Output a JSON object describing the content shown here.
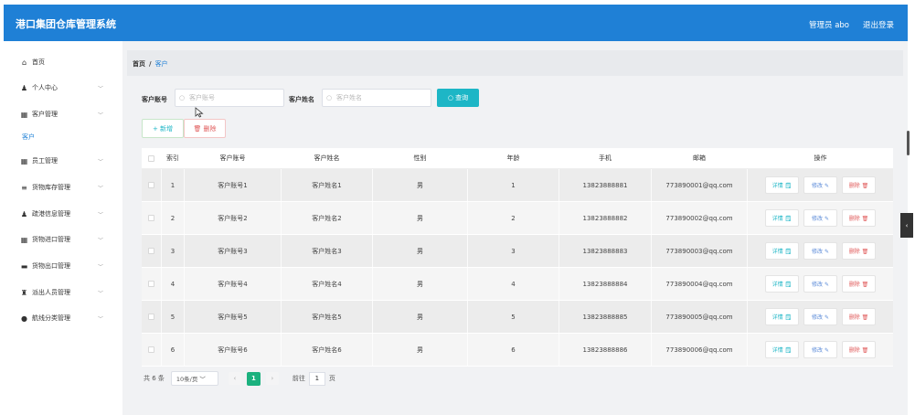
{
  "header": {
    "title": "港口集团仓库管理系统",
    "user": "管理员 abo",
    "logout": "退出登录"
  },
  "sidebar": {
    "items": [
      {
        "label": "首页",
        "icon": "home-icon",
        "glyph": "⌂",
        "chevron": ""
      },
      {
        "label": "个人中心",
        "icon": "user-icon",
        "glyph": "♟",
        "chevron": "﹀"
      },
      {
        "label": "客户管理",
        "icon": "grid-icon",
        "glyph": "▦",
        "chevron": "﹀"
      },
      {
        "label": "员工管理",
        "icon": "grid-icon",
        "glyph": "▦",
        "chevron": "﹀"
      },
      {
        "label": "货物库存管理",
        "icon": "list-icon",
        "glyph": "≡",
        "chevron": "﹀"
      },
      {
        "label": "疏港信息管理",
        "icon": "user-icon",
        "glyph": "♟",
        "chevron": "﹀"
      },
      {
        "label": "货物进口管理",
        "icon": "grid-icon",
        "glyph": "▦",
        "chevron": "﹀"
      },
      {
        "label": "货物出口管理",
        "icon": "ship-icon",
        "glyph": "▬",
        "chevron": "﹀"
      },
      {
        "label": "派出人员管理",
        "icon": "person-icon",
        "glyph": "♜",
        "chevron": "﹀"
      },
      {
        "label": "航线分类管理",
        "icon": "pin-icon",
        "glyph": "●",
        "chevron": "﹀"
      }
    ],
    "submenu_label": "客户"
  },
  "breadcrumb": {
    "home": "首页",
    "sep": "/",
    "current": "客户"
  },
  "filters": {
    "account_label": "客户账号",
    "account_placeholder": "客户账号",
    "name_label": "客户姓名",
    "name_placeholder": "客户姓名",
    "search_glyph": "○",
    "query_button": "○ 查询"
  },
  "actions": {
    "add": "+ 新增",
    "delete": "🗑 删除"
  },
  "table": {
    "headers": [
      "",
      "索引",
      "客户账号",
      "客户姓名",
      "性别",
      "年龄",
      "手机",
      "邮箱",
      "操作"
    ],
    "rows": [
      {
        "idx": "1",
        "account": "客户账号1",
        "name": "客户姓名1",
        "gender": "男",
        "age": "1",
        "phone": "13823888881",
        "email": "773890001@qq.com"
      },
      {
        "idx": "2",
        "account": "客户账号2",
        "name": "客户姓名2",
        "gender": "男",
        "age": "2",
        "phone": "13823888882",
        "email": "773890002@qq.com"
      },
      {
        "idx": "3",
        "account": "客户账号3",
        "name": "客户姓名3",
        "gender": "男",
        "age": "3",
        "phone": "13823888883",
        "email": "773890003@qq.com"
      },
      {
        "idx": "4",
        "account": "客户账号4",
        "name": "客户姓名4",
        "gender": "男",
        "age": "4",
        "phone": "13823888884",
        "email": "773890004@qq.com"
      },
      {
        "idx": "5",
        "account": "客户账号5",
        "name": "客户姓名5",
        "gender": "男",
        "age": "5",
        "phone": "13823888885",
        "email": "773890005@qq.com"
      },
      {
        "idx": "6",
        "account": "客户账号6",
        "name": "客户姓名6",
        "gender": "男",
        "age": "6",
        "phone": "13823888886",
        "email": "773890006@qq.com"
      }
    ],
    "op_detail": "详情 🗒",
    "op_edit": "修改 ✎",
    "op_delete": "删除 🗑"
  },
  "pagination": {
    "total": "共 6 条",
    "page_size": "10条/页 ﹀",
    "prev": "‹",
    "current": "1",
    "next": "›",
    "goto_label": "前往",
    "goto_value": "1",
    "page_suffix": "页"
  },
  "edge_tab": "‹",
  "colors": {
    "header": "#1f80d6",
    "query": "#1db6c6",
    "page_active": "#1bb17e",
    "danger": "#e05a5a"
  }
}
